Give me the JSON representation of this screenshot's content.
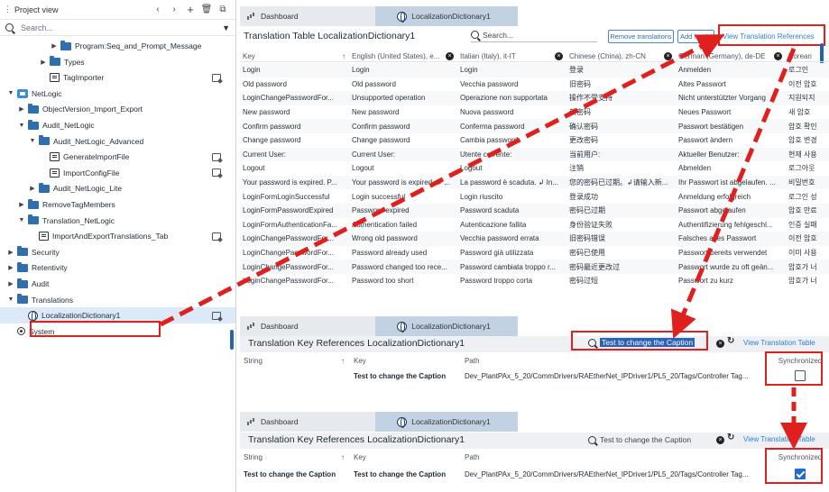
{
  "project_view": {
    "title": "Project view",
    "search_placeholder": "Search...",
    "tree": [
      {
        "label": "Program:Seq_and_Prompt_Message",
        "indent": 4,
        "twisty": "▶",
        "icon": "folder",
        "action": false
      },
      {
        "label": "Types",
        "indent": 3,
        "twisty": "▶",
        "icon": "folder",
        "action": false
      },
      {
        "label": "TagImporter",
        "indent": 3,
        "twisty": "",
        "icon": "script",
        "action": true
      },
      {
        "label": "NetLogic",
        "indent": 0,
        "twisty": "▼",
        "icon": "netlogic",
        "action": false
      },
      {
        "label": "ObjectVersion_Import_Export",
        "indent": 1,
        "twisty": "▶",
        "icon": "folder",
        "action": false
      },
      {
        "label": "Audit_NetLogic",
        "indent": 1,
        "twisty": "▼",
        "icon": "folder",
        "action": false
      },
      {
        "label": "Audit_NetLogic_Advanced",
        "indent": 2,
        "twisty": "▼",
        "icon": "folder",
        "action": false
      },
      {
        "label": "GenerateImportFile",
        "indent": 3,
        "twisty": "",
        "icon": "script",
        "action": true
      },
      {
        "label": "ImportConfigFile",
        "indent": 3,
        "twisty": "",
        "icon": "script",
        "action": true
      },
      {
        "label": "Audit_NetLogic_Lite",
        "indent": 2,
        "twisty": "▶",
        "icon": "folder",
        "action": false
      },
      {
        "label": "RemoveTagMembers",
        "indent": 1,
        "twisty": "▶",
        "icon": "folder",
        "action": false
      },
      {
        "label": "Translation_NetLogic",
        "indent": 1,
        "twisty": "▼",
        "icon": "folder",
        "action": false
      },
      {
        "label": "ImportAndExportTranslations_Tab",
        "indent": 2,
        "twisty": "",
        "icon": "script",
        "action": true
      },
      {
        "label": "Security",
        "indent": 0,
        "twisty": "▶",
        "icon": "folder",
        "action": false
      },
      {
        "label": "Retentivity",
        "indent": 0,
        "twisty": "▶",
        "icon": "folder",
        "action": false
      },
      {
        "label": "Audit",
        "indent": 0,
        "twisty": "▶",
        "icon": "folder",
        "action": false
      },
      {
        "label": "Translations",
        "indent": 0,
        "twisty": "▼",
        "icon": "folder",
        "action": false
      },
      {
        "label": "LocalizationDictionary1",
        "indent": 1,
        "twisty": "",
        "icon": "globe",
        "action": true,
        "selected": true
      },
      {
        "label": "System",
        "indent": 0,
        "twisty": "",
        "icon": "radio",
        "action": false
      }
    ]
  },
  "tabs": {
    "dashboard": "Dashboard",
    "dictionary": "LocalizationDictionary1"
  },
  "translation_table": {
    "title": "Translation Table LocalizationDictionary1",
    "search_placeholder": "Search...",
    "remove_btn": "Remove translations",
    "add_locale_btn": "Add locale",
    "view_refs_btn": "View Translation References",
    "columns": [
      "Key",
      "English (United States), e...",
      "Italian (Italy), it-IT",
      "Chinese (China), zh-CN",
      "German (Germany), de-DE",
      "Korean"
    ],
    "rows": [
      [
        "Login",
        "Login",
        "Login",
        "登录",
        "Anmelden",
        "로그인"
      ],
      [
        "Old password",
        "Old password",
        "Vecchia password",
        "旧密码",
        "Altes Passwort",
        "이전 암호"
      ],
      [
        "LoginChangePasswordFor...",
        "Unsupported operation",
        "Operazione non supportata",
        "操作不受支持",
        "Nicht unterstützter Vorgang",
        "지원되지"
      ],
      [
        "New password",
        "New password",
        "Nuova password",
        "新密码",
        "Neues Passwort",
        "새 암호"
      ],
      [
        "Confirm password",
        "Confirm password",
        "Conferma password",
        "确认密码",
        "Passwort bestätigen",
        "암호 확인"
      ],
      [
        "Change password",
        "Change password",
        "Cambia password",
        "更改密码",
        "Passwort ändern",
        "암호 변경"
      ],
      [
        "Current User:",
        "Current User:",
        "Utente corrente:",
        "当前用户:",
        "Aktueller Benutzer:",
        "현재 사용"
      ],
      [
        "Logout",
        "Logout",
        "Logout",
        "注销",
        "Abmelden",
        "로그아웃"
      ],
      [
        "Your password is expired. P...",
        "Your password is expired. ↲ ...",
        "La password è scaduta. ↲ In...",
        "您的密码已过期。↲请输入新...",
        "Ihr Passwort ist abgelaufen. ...",
        "비밀번호"
      ],
      [
        "LoginFormLoginSuccessful",
        "Login successful",
        "Login riuscito",
        "登录成功",
        "Anmeldung erfolgreich",
        "로그인 성"
      ],
      [
        "LoginFormPasswordExpired",
        "Password expired",
        "Password scaduta",
        "密码已过期",
        "Passwort abgelaufen",
        "암호 만료"
      ],
      [
        "LoginFormAuthenticationFa...",
        "Authentication failed",
        "Autenticazione fallita",
        "身份验证失败",
        "Authentifizierung fehlgeschl...",
        "인증 실패"
      ],
      [
        "LoginChangePasswordFor...",
        "Wrong old password",
        "Vecchia password errata",
        "旧密码错误",
        "Falsches altes Passwort",
        "이전 암호"
      ],
      [
        "LoginChangePasswordFor...",
        "Password already used",
        "Password già utilizzata",
        "密码已使用",
        "Passwort bereits verwendet",
        "이미 사용"
      ],
      [
        "LoginChangePasswordFor...",
        "Password changed too rece...",
        "Password cambiata troppo r...",
        "密码最近更改过",
        "Passwort wurde zu oft geän...",
        "암호가 너"
      ],
      [
        "LoginChangePasswordFor...",
        "Password too short",
        "Password troppo corta",
        "密码过短",
        "Passwort zu kurz",
        "암호가 너"
      ]
    ]
  },
  "key_refs_1": {
    "title": "Translation Key References LocalizationDictionary1",
    "search_value": "Test to change the Caption",
    "view_table_btn": "View Translation Table",
    "columns": [
      "String",
      "Key",
      "Path",
      "Synchronized"
    ],
    "row": {
      "string": "",
      "key": "Test to change the Caption",
      "path": "Dev_PlantPAx_5_20/CommDrivers/RAEtherNet_IPDriver1/PL5_20/Tags/Controller Tag...",
      "synchronized": false
    }
  },
  "key_refs_2": {
    "title": "Translation Key References LocalizationDictionary1",
    "search_value": "Test to change the Caption",
    "view_table_btn": "View Translation Table",
    "columns": [
      "String",
      "Key",
      "Path",
      "Synchronized"
    ],
    "row": {
      "string": "Test to change the Caption",
      "key": "Test to change the Caption",
      "path": "Dev_PlantPAx_5_20/CommDrivers/RAEtherNet_IPDriver1/PL5_20/Tags/Controller Tag...",
      "synchronized": true
    }
  },
  "annotation_color": "#e0201f",
  "accent_color": "#2d7fd0"
}
